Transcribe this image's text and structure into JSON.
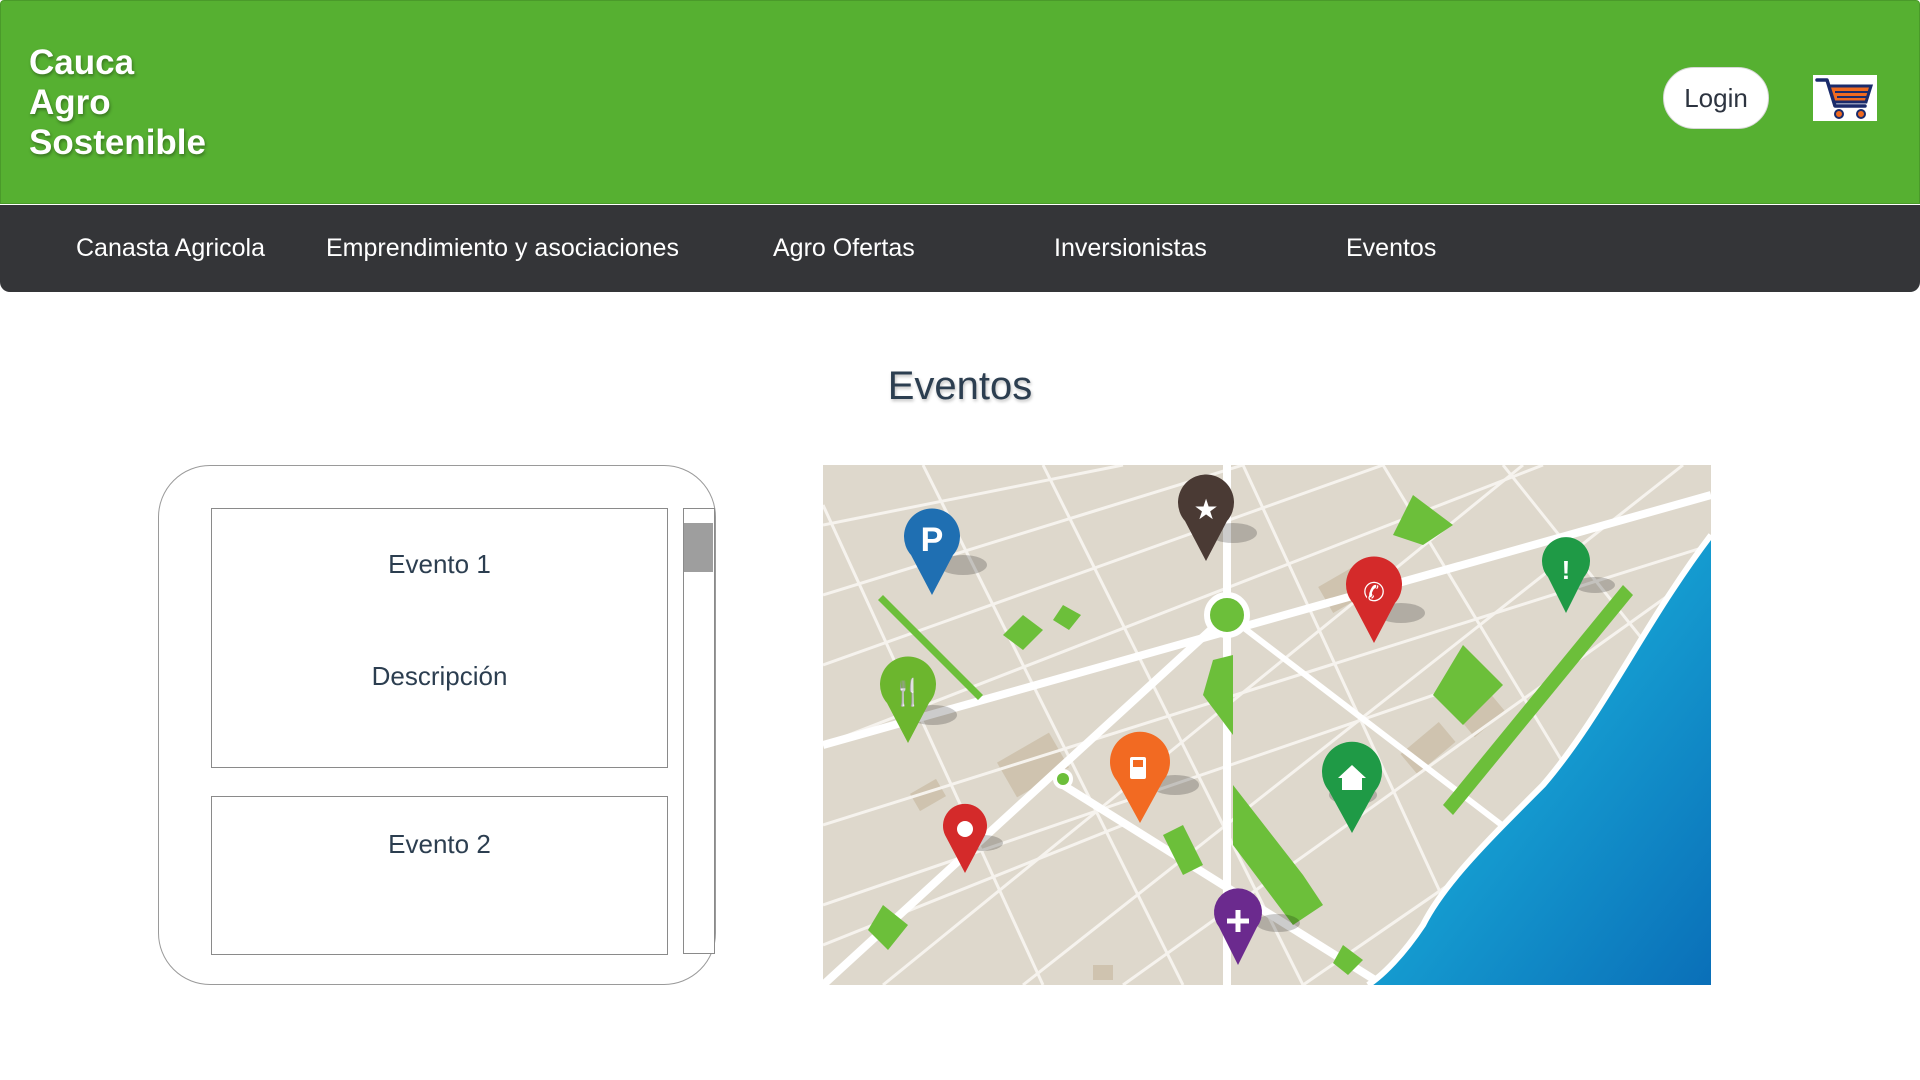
{
  "header": {
    "brand_lines": [
      "Cauca",
      "Agro",
      "Sostenible"
    ],
    "login_label": "Login",
    "cart_icon": "shopping-cart-icon",
    "bg_color": "#56b031"
  },
  "nav": {
    "items": [
      {
        "label": "Canasta Agricola"
      },
      {
        "label": "Emprendimiento y asociaciones"
      },
      {
        "label": "Agro Ofertas"
      },
      {
        "label": "Inversionistas"
      },
      {
        "label": "Eventos"
      }
    ],
    "bg_color": "#343538"
  },
  "main": {
    "title": "Eventos",
    "events": [
      {
        "title": "Evento 1",
        "description": "Descripción"
      },
      {
        "title": "Evento 2",
        "description": ""
      }
    ],
    "map": {
      "pins": [
        {
          "icon": "parking-icon",
          "color": "#1f6fb2"
        },
        {
          "icon": "star-icon",
          "color": "#4a3a34"
        },
        {
          "icon": "phone-icon",
          "color": "#d42a2a"
        },
        {
          "icon": "alert-icon",
          "color": "#1f9a46"
        },
        {
          "icon": "restaurant-icon",
          "color": "#6cb62e"
        },
        {
          "icon": "fuel-icon",
          "color": "#f26a22"
        },
        {
          "icon": "home-icon",
          "color": "#1f9a46"
        },
        {
          "icon": "location-icon",
          "color": "#d42a2a"
        },
        {
          "icon": "medical-icon",
          "color": "#6b2a8e"
        }
      ]
    }
  }
}
